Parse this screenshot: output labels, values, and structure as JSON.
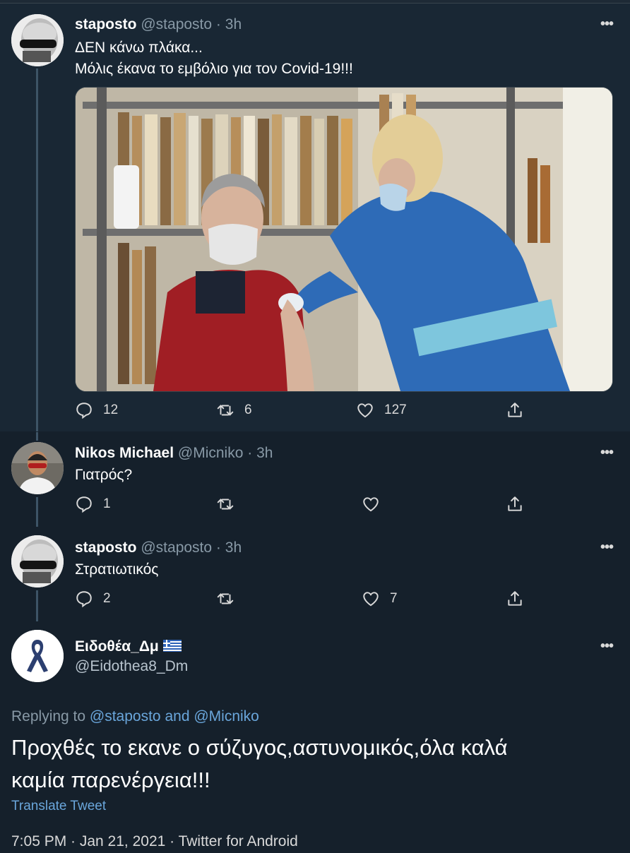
{
  "tweets": [
    {
      "name": "staposto",
      "handle": "@staposto",
      "time": "3h",
      "text_lines": [
        "ΔΕΝ κάνω πλάκα...",
        "Μόλις έκανα το εμβόλιο για τον Covid-19!!!"
      ],
      "replies": "12",
      "retweets": "6",
      "likes": "127"
    },
    {
      "name": "Nikos Michael",
      "handle": "@Micniko",
      "time": "3h",
      "text": "Γιατρός?",
      "replies": "1",
      "retweets": "",
      "likes": ""
    },
    {
      "name": "staposto",
      "handle": "@staposto",
      "time": "3h",
      "text": "Στρατιωτικός",
      "replies": "2",
      "retweets": "",
      "likes": "7"
    }
  ],
  "main_tweet": {
    "name": "Ειδοθέα_Δμ",
    "handle": "@Eidothea8_Dm",
    "replying_prefix": "Replying to ",
    "replying_mention1": "@staposto",
    "replying_and": " and ",
    "replying_mention2": "@Micniko",
    "text_line1": "Προχθές το εκανε ο σύζυγος,αστυνομικός,όλα καλά",
    "text_line2": "καμία παρενέργεια!!!",
    "translate": "Translate Tweet",
    "meta": "7:05 PM · Jan 21, 2021 · Twitter for Android"
  },
  "ui": {
    "separator": "·",
    "more": "•••"
  },
  "icons": {
    "reply": "reply-icon",
    "retweet": "retweet-icon",
    "like": "heart-icon",
    "share": "share-icon",
    "more": "more-icon",
    "flag": "greek-flag-icon"
  },
  "colors": {
    "background": "#15202b",
    "highlight": "#192734",
    "secondary_text": "#8899a6",
    "link": "#6aa6db"
  }
}
